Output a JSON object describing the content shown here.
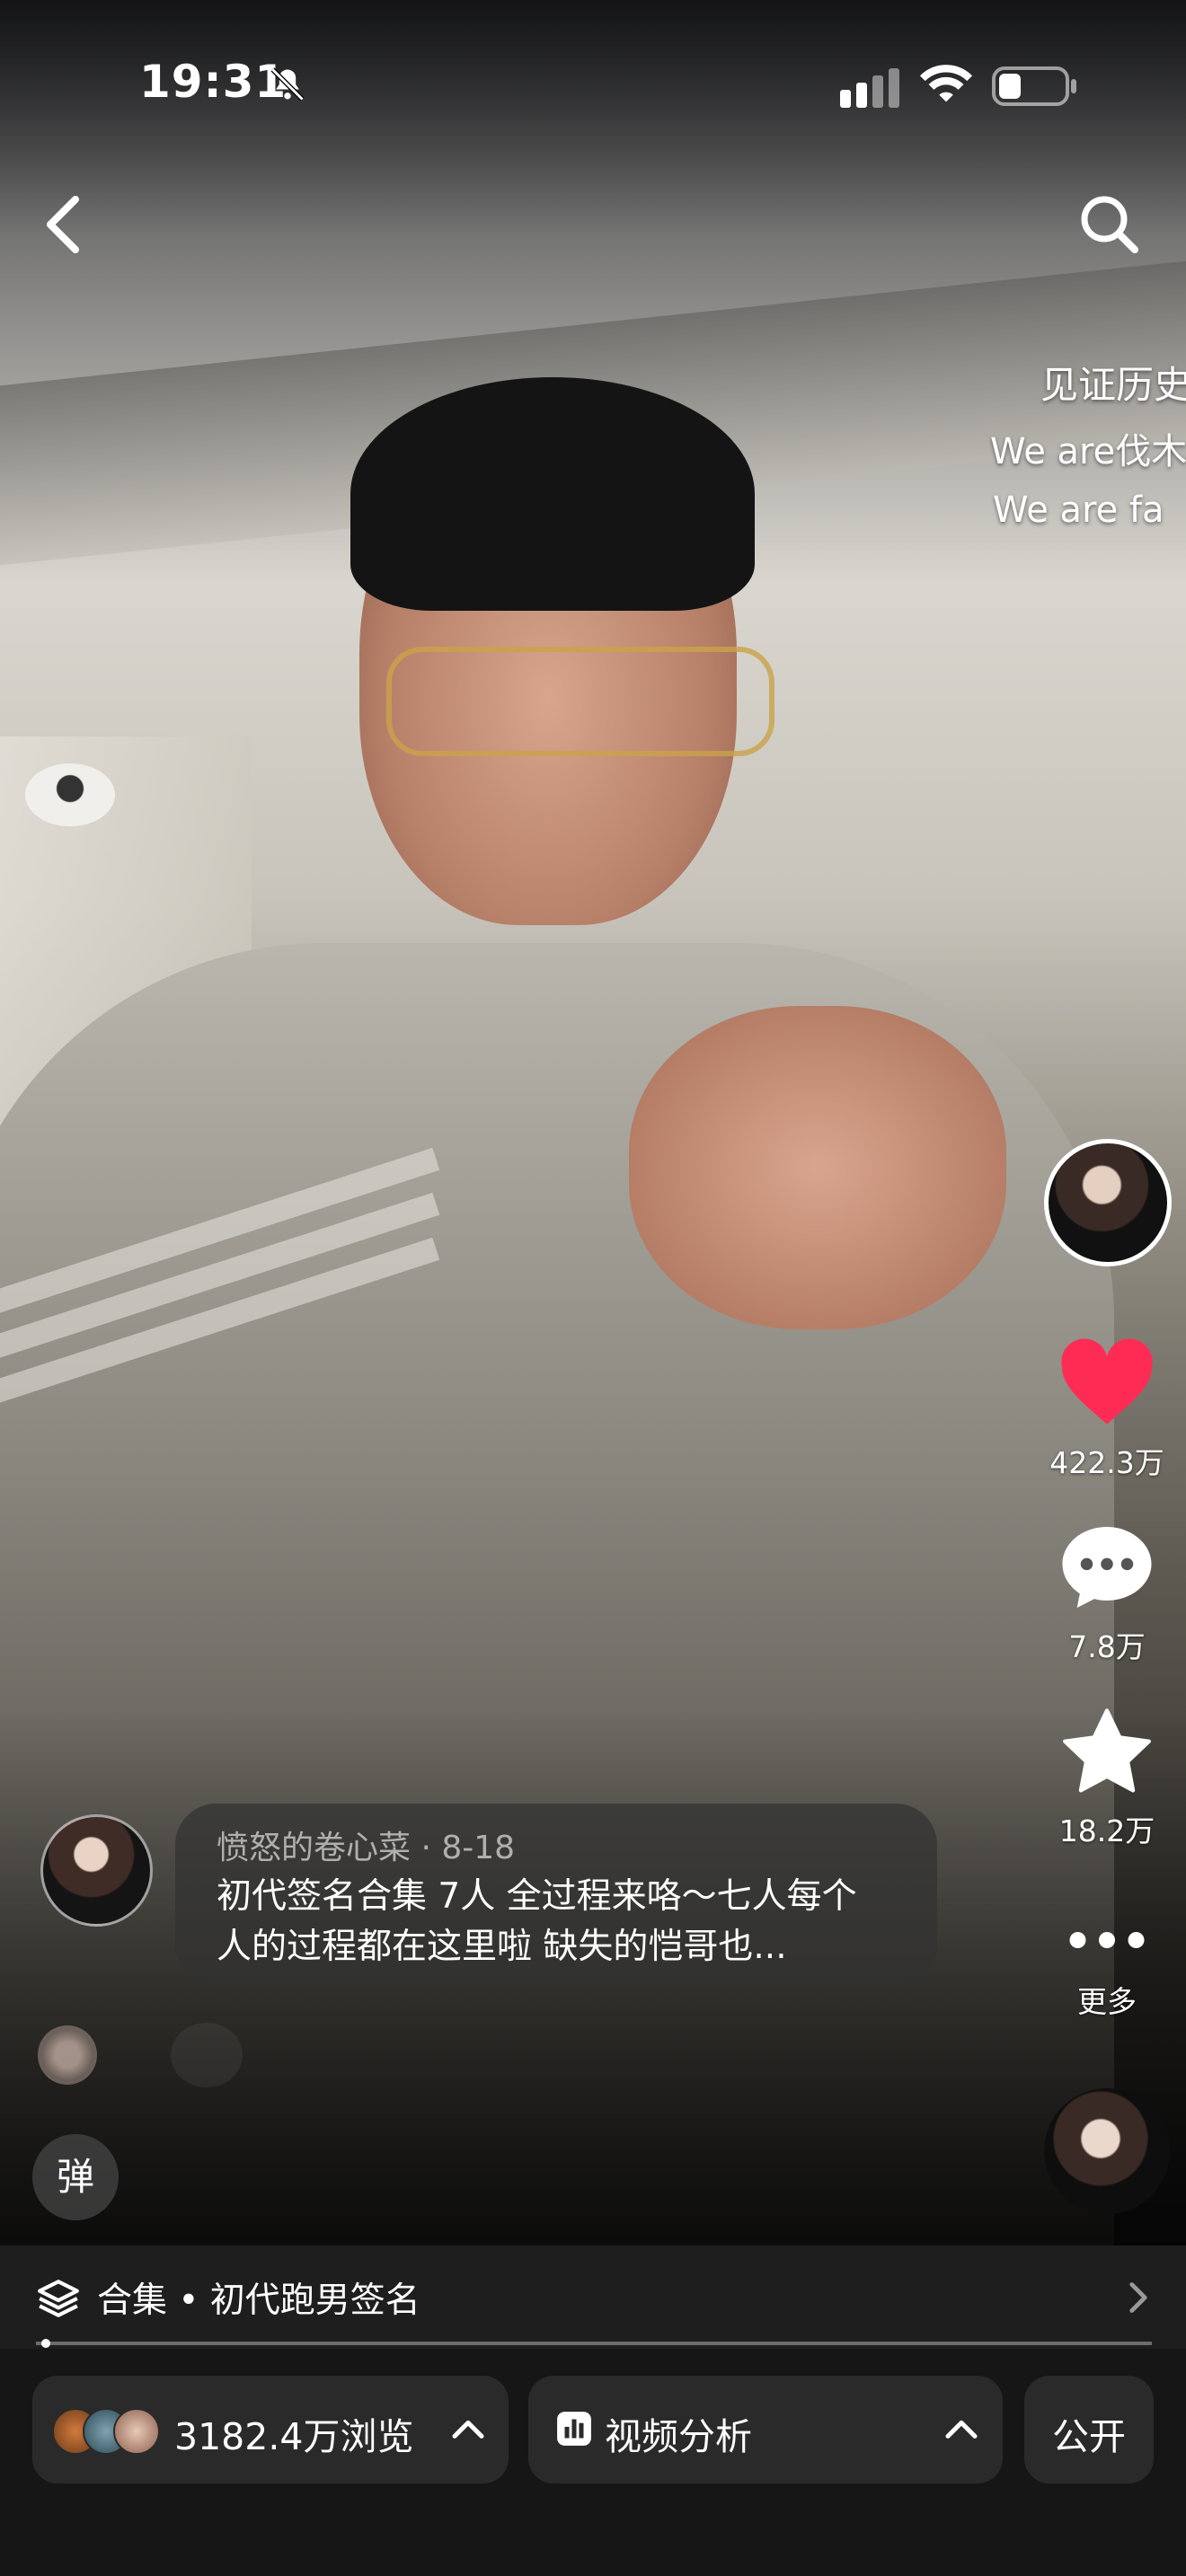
{
  "status_bar": {
    "time": "19:31"
  },
  "video": {
    "overlay_lines": [
      "见证历史",
      "We are伐木",
      "We are fa"
    ]
  },
  "side_rail": {
    "likes": "422.3万",
    "comments": "7.8万",
    "favorites": "18.2万",
    "more_label": "更多"
  },
  "post": {
    "author": "愤怒的卷心菜",
    "date": "8-18",
    "separator": "·",
    "caption_line1": "初代签名合集 7人 全过程来咯～七人每个",
    "caption_line2": "人的过程都在这里啦 缺失的恺哥也..."
  },
  "danmu_label": "弹",
  "collection": {
    "label": "合集 • 初代跑男签名"
  },
  "progress": {
    "fraction": 0.005
  },
  "bottom": {
    "views": "3182.4万浏览",
    "analysis": "视频分析",
    "public": "公开"
  },
  "colors": {
    "like": "#fe2c55",
    "panel": "#2a2a2a",
    "bar": "#161616"
  }
}
